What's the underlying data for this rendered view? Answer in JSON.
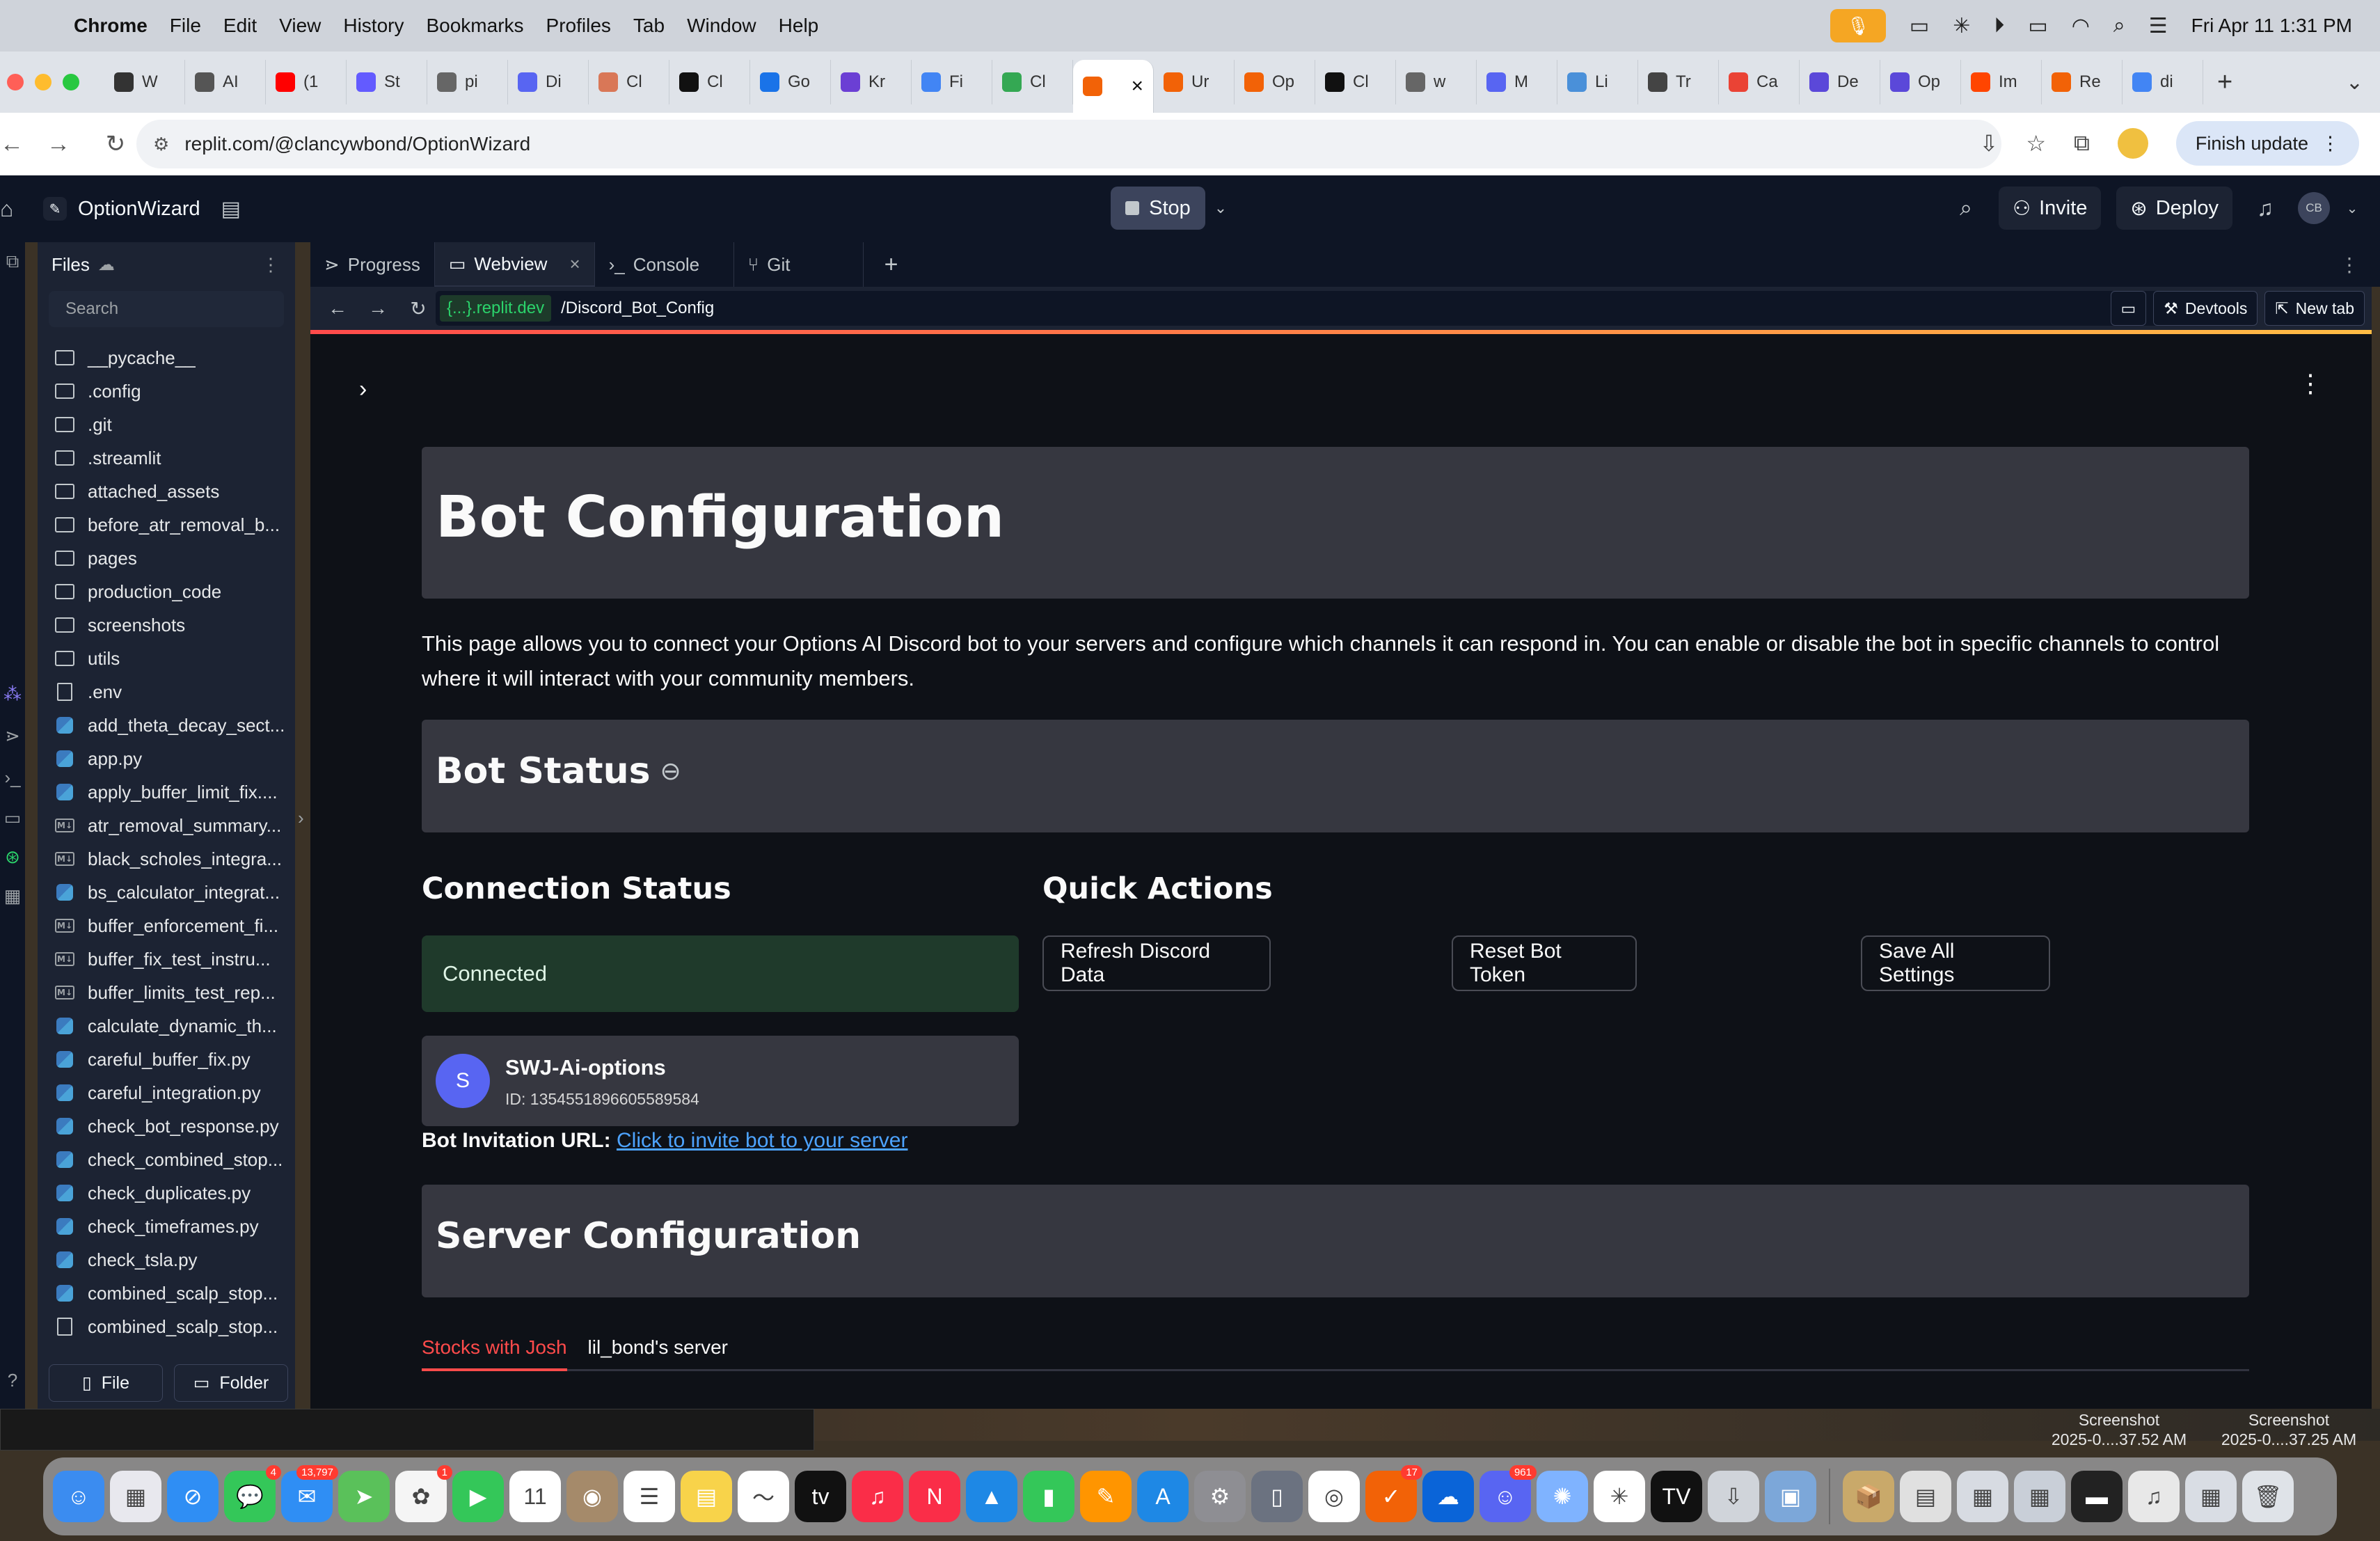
{
  "menubar": {
    "app": "Chrome",
    "items": [
      "File",
      "Edit",
      "View",
      "History",
      "Bookmarks",
      "Profiles",
      "Tab",
      "Window",
      "Help"
    ],
    "datetime": "Fri Apr 11  1:31 PM"
  },
  "tabs": [
    {
      "label": "W",
      "color": "#333333",
      "icon": "openai-icon"
    },
    {
      "label": "AI",
      "color": "#555555",
      "icon": "pause-icon"
    },
    {
      "label": "(1",
      "color": "#ff0000",
      "icon": "youtube-icon"
    },
    {
      "label": "St",
      "color": "#635bff",
      "icon": "stripe-icon"
    },
    {
      "label": "pi",
      "color": "#666666",
      "icon": "globe-icon"
    },
    {
      "label": "Di",
      "color": "#5865f2",
      "icon": "discord-icon"
    },
    {
      "label": "Cl",
      "color": "#d97757",
      "icon": "claude-icon"
    },
    {
      "label": "Cl",
      "color": "#111111",
      "icon": "openai-icon"
    },
    {
      "label": "Go",
      "color": "#1a73e8",
      "icon": "gemini-icon"
    },
    {
      "label": "Kr",
      "color": "#6b3fd4",
      "icon": "kr-icon"
    },
    {
      "label": "Fi",
      "color": "#4285f4",
      "icon": "firebase-icon"
    },
    {
      "label": "Cl",
      "color": "#34a853",
      "icon": "drive-icon"
    },
    {
      "label": "",
      "color": "#f26207",
      "icon": "replit-icon",
      "active": true
    },
    {
      "label": "Ur",
      "color": "#f26207",
      "icon": "replit-icon"
    },
    {
      "label": "Op",
      "color": "#f26207",
      "icon": "replit-icon"
    },
    {
      "label": "Cl",
      "color": "#111111",
      "icon": "github-icon"
    },
    {
      "label": "w",
      "color": "#666666",
      "icon": "globe-icon"
    },
    {
      "label": "M",
      "color": "#5865f2",
      "icon": "discord-icon"
    },
    {
      "label": "Li",
      "color": "#4a90d9",
      "icon": "globe-icon"
    },
    {
      "label": "Tr",
      "color": "#444444",
      "icon": "tr-icon"
    },
    {
      "label": "Ca",
      "color": "#ea4335",
      "icon": "gmail-icon"
    },
    {
      "label": "De",
      "color": "#5b48d9",
      "icon": "de-icon"
    },
    {
      "label": "Op",
      "color": "#5b48d9",
      "icon": "op-icon"
    },
    {
      "label": "Im",
      "color": "#ff4500",
      "icon": "reddit-icon"
    },
    {
      "label": "Re",
      "color": "#f26207",
      "icon": "replit-icon"
    },
    {
      "label": "di",
      "color": "#4285f4",
      "icon": "google-icon"
    }
  ],
  "addressbar": {
    "url": "replit.com/@clancywbond/OptionWizard",
    "finish_update": "Finish update"
  },
  "replit": {
    "project_name": "OptionWizard",
    "stop_label": "Stop",
    "invite_label": "Invite",
    "deploy_label": "Deploy",
    "avatar_initials": "CB"
  },
  "files": {
    "title": "Files",
    "search_placeholder": "Search",
    "items": [
      {
        "name": "__pycache__",
        "type": "folder"
      },
      {
        "name": ".config",
        "type": "folder"
      },
      {
        "name": ".git",
        "type": "folder"
      },
      {
        "name": ".streamlit",
        "type": "folder"
      },
      {
        "name": "attached_assets",
        "type": "folder"
      },
      {
        "name": "before_atr_removal_b...",
        "type": "folder"
      },
      {
        "name": "pages",
        "type": "folder"
      },
      {
        "name": "production_code",
        "type": "folder"
      },
      {
        "name": "screenshots",
        "type": "folder"
      },
      {
        "name": "utils",
        "type": "folder"
      },
      {
        "name": ".env",
        "type": "file"
      },
      {
        "name": "add_theta_decay_sect...",
        "type": "py"
      },
      {
        "name": "app.py",
        "type": "py"
      },
      {
        "name": "apply_buffer_limit_fix....",
        "type": "py"
      },
      {
        "name": "atr_removal_summary...",
        "type": "md"
      },
      {
        "name": "black_scholes_integra...",
        "type": "md"
      },
      {
        "name": "bs_calculator_integrat...",
        "type": "py"
      },
      {
        "name": "buffer_enforcement_fi...",
        "type": "md"
      },
      {
        "name": "buffer_fix_test_instru...",
        "type": "md"
      },
      {
        "name": "buffer_limits_test_rep...",
        "type": "md"
      },
      {
        "name": "calculate_dynamic_th...",
        "type": "py"
      },
      {
        "name": "careful_buffer_fix.py",
        "type": "py"
      },
      {
        "name": "careful_integration.py",
        "type": "py"
      },
      {
        "name": "check_bot_response.py",
        "type": "py"
      },
      {
        "name": "check_combined_stop...",
        "type": "py"
      },
      {
        "name": "check_duplicates.py",
        "type": "py"
      },
      {
        "name": "check_timeframes.py",
        "type": "py"
      },
      {
        "name": "check_tsla.py",
        "type": "py"
      },
      {
        "name": "combined_scalp_stop...",
        "type": "py"
      },
      {
        "name": "combined_scalp_stop...",
        "type": "file"
      }
    ],
    "file_button": "File",
    "folder_button": "Folder"
  },
  "pane_tabs": {
    "progress": "Progress",
    "webview": "Webview",
    "console": "Console",
    "git": "Git"
  },
  "webview": {
    "host": "{...}.replit.dev",
    "path": "/Discord_Bot_Config",
    "devtools": "Devtools",
    "newtab": "New tab"
  },
  "page": {
    "title": "Bot Configuration",
    "intro": "This page allows you to connect your Options AI Discord bot to your servers and configure which channels it can respond in. You can enable or disable the bot in specific channels to control where it will interact with your community members.",
    "bot_status_heading": "Bot Status",
    "connection_status_heading": "Connection Status",
    "connected_text": "Connected",
    "bot_avatar_letter": "S",
    "bot_name": "SWJ-Ai-options",
    "bot_id": "ID: 1354551896605589584",
    "invite_label": "Bot Invitation URL:",
    "invite_link": "Click to invite bot to your server",
    "quick_actions_heading": "Quick Actions",
    "refresh_button": "Refresh Discord Data",
    "reset_button": "Reset Bot Token",
    "save_button": "Save All Settings",
    "server_config_heading": "Server Configuration",
    "server_tabs": [
      "Stocks with Josh",
      "lil_bond's server"
    ]
  },
  "desktop": {
    "screenshot_1": "Screenshot\n2025-0....37.52 AM",
    "screenshot_2": "Screenshot\n2025-0....37.25 AM"
  },
  "dock": {
    "apps": [
      {
        "name": "finder-icon",
        "color": "#3b8cf0",
        "glyph": "☺"
      },
      {
        "name": "launchpad-icon",
        "color": "#e8e8ee",
        "glyph": "▦"
      },
      {
        "name": "safari-icon",
        "color": "#2f8ef4",
        "glyph": "⊘"
      },
      {
        "name": "messages-icon",
        "color": "#34c759",
        "glyph": "💬",
        "badge": "4"
      },
      {
        "name": "mail-icon",
        "color": "#2f8ef4",
        "glyph": "✉",
        "badge": "13,797"
      },
      {
        "name": "maps-icon",
        "color": "#5ac15a",
        "glyph": "➤"
      },
      {
        "name": "photos-icon",
        "color": "#f5f5f5",
        "glyph": "✿",
        "badge": "1"
      },
      {
        "name": "facetime-icon",
        "color": "#34c759",
        "glyph": "▶"
      },
      {
        "name": "calendar-icon",
        "color": "#ffffff",
        "glyph": "11"
      },
      {
        "name": "contacts-icon",
        "color": "#a58a6a",
        "glyph": "◉"
      },
      {
        "name": "reminders-icon",
        "color": "#ffffff",
        "glyph": "☰"
      },
      {
        "name": "notes-icon",
        "color": "#f8d34a",
        "glyph": "▤"
      },
      {
        "name": "freeform-icon",
        "color": "#ffffff",
        "glyph": "〜"
      },
      {
        "name": "tv-icon",
        "color": "#111111",
        "glyph": "tv"
      },
      {
        "name": "music-icon",
        "color": "#fa2d48",
        "glyph": "♫"
      },
      {
        "name": "news-icon",
        "color": "#fa2d48",
        "glyph": "N"
      },
      {
        "name": "keynote-icon",
        "color": "#1e88e5",
        "glyph": "▲"
      },
      {
        "name": "numbers-icon",
        "color": "#34c759",
        "glyph": "▮"
      },
      {
        "name": "pages-icon",
        "color": "#ff9500",
        "glyph": "✎"
      },
      {
        "name": "appstore-icon",
        "color": "#1e88e5",
        "glyph": "A"
      },
      {
        "name": "settings-icon",
        "color": "#8e8e93",
        "glyph": "⚙"
      },
      {
        "name": "iphone-mirroring-icon",
        "color": "#6b7280",
        "glyph": "▯"
      },
      {
        "name": "chrome-icon",
        "color": "#ffffff",
        "glyph": "◎"
      },
      {
        "name": "todo-icon",
        "color": "#f26207",
        "glyph": "✓",
        "badge": "17"
      },
      {
        "name": "cloud-icon",
        "color": "#0a64d8",
        "glyph": "☁"
      },
      {
        "name": "discord-icon",
        "color": "#5865f2",
        "glyph": "☺",
        "badge": "961"
      },
      {
        "name": "brain-icon",
        "color": "#7fb3ff",
        "glyph": "✺"
      },
      {
        "name": "chatgpt-icon",
        "color": "#ffffff",
        "glyph": "✳"
      },
      {
        "name": "tradingview-icon",
        "color": "#111111",
        "glyph": "TV"
      },
      {
        "name": "installer-icon",
        "color": "#d0d4da",
        "glyph": "⇩"
      },
      {
        "name": "preview-icon",
        "color": "#7ca7d9",
        "glyph": "▣"
      }
    ],
    "stack": [
      {
        "name": "downloads-stack-icon",
        "color": "#c9a96a",
        "glyph": "📦"
      },
      {
        "name": "document-stack-icon",
        "color": "#e0e0e0",
        "glyph": "▤"
      },
      {
        "name": "screenshot-stack-icon",
        "color": "#d7dbe2",
        "glyph": "▦"
      },
      {
        "name": "screenshot-stack-icon-2",
        "color": "#c9cfd8",
        "glyph": "▦"
      },
      {
        "name": "terminal-window-icon",
        "color": "#222222",
        "glyph": "▬"
      },
      {
        "name": "audio-file-icon",
        "color": "#e8e8e8",
        "glyph": "♫"
      },
      {
        "name": "window-thumb-icon",
        "color": "#d9dde4",
        "glyph": "▦"
      },
      {
        "name": "trash-icon",
        "color": "#dfe3e8",
        "glyph": "🗑"
      }
    ]
  }
}
